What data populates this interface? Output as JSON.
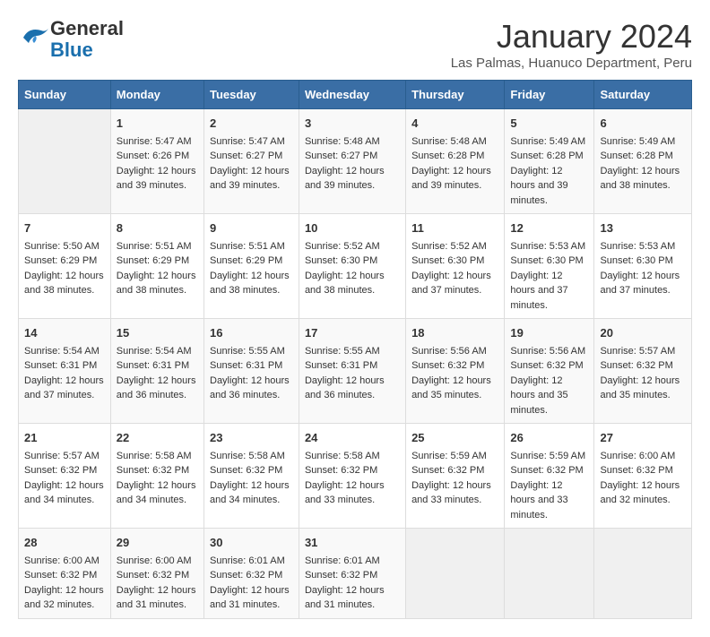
{
  "header": {
    "logo_general": "General",
    "logo_blue": "Blue",
    "month": "January 2024",
    "location": "Las Palmas, Huanuco Department, Peru"
  },
  "weekdays": [
    "Sunday",
    "Monday",
    "Tuesday",
    "Wednesday",
    "Thursday",
    "Friday",
    "Saturday"
  ],
  "weeks": [
    [
      {
        "day": "",
        "sunrise": "",
        "sunset": "",
        "daylight": ""
      },
      {
        "day": "1",
        "sunrise": "Sunrise: 5:47 AM",
        "sunset": "Sunset: 6:26 PM",
        "daylight": "Daylight: 12 hours and 39 minutes."
      },
      {
        "day": "2",
        "sunrise": "Sunrise: 5:47 AM",
        "sunset": "Sunset: 6:27 PM",
        "daylight": "Daylight: 12 hours and 39 minutes."
      },
      {
        "day": "3",
        "sunrise": "Sunrise: 5:48 AM",
        "sunset": "Sunset: 6:27 PM",
        "daylight": "Daylight: 12 hours and 39 minutes."
      },
      {
        "day": "4",
        "sunrise": "Sunrise: 5:48 AM",
        "sunset": "Sunset: 6:28 PM",
        "daylight": "Daylight: 12 hours and 39 minutes."
      },
      {
        "day": "5",
        "sunrise": "Sunrise: 5:49 AM",
        "sunset": "Sunset: 6:28 PM",
        "daylight": "Daylight: 12 hours and 39 minutes."
      },
      {
        "day": "6",
        "sunrise": "Sunrise: 5:49 AM",
        "sunset": "Sunset: 6:28 PM",
        "daylight": "Daylight: 12 hours and 38 minutes."
      }
    ],
    [
      {
        "day": "7",
        "sunrise": "Sunrise: 5:50 AM",
        "sunset": "Sunset: 6:29 PM",
        "daylight": "Daylight: 12 hours and 38 minutes."
      },
      {
        "day": "8",
        "sunrise": "Sunrise: 5:51 AM",
        "sunset": "Sunset: 6:29 PM",
        "daylight": "Daylight: 12 hours and 38 minutes."
      },
      {
        "day": "9",
        "sunrise": "Sunrise: 5:51 AM",
        "sunset": "Sunset: 6:29 PM",
        "daylight": "Daylight: 12 hours and 38 minutes."
      },
      {
        "day": "10",
        "sunrise": "Sunrise: 5:52 AM",
        "sunset": "Sunset: 6:30 PM",
        "daylight": "Daylight: 12 hours and 38 minutes."
      },
      {
        "day": "11",
        "sunrise": "Sunrise: 5:52 AM",
        "sunset": "Sunset: 6:30 PM",
        "daylight": "Daylight: 12 hours and 37 minutes."
      },
      {
        "day": "12",
        "sunrise": "Sunrise: 5:53 AM",
        "sunset": "Sunset: 6:30 PM",
        "daylight": "Daylight: 12 hours and 37 minutes."
      },
      {
        "day": "13",
        "sunrise": "Sunrise: 5:53 AM",
        "sunset": "Sunset: 6:30 PM",
        "daylight": "Daylight: 12 hours and 37 minutes."
      }
    ],
    [
      {
        "day": "14",
        "sunrise": "Sunrise: 5:54 AM",
        "sunset": "Sunset: 6:31 PM",
        "daylight": "Daylight: 12 hours and 37 minutes."
      },
      {
        "day": "15",
        "sunrise": "Sunrise: 5:54 AM",
        "sunset": "Sunset: 6:31 PM",
        "daylight": "Daylight: 12 hours and 36 minutes."
      },
      {
        "day": "16",
        "sunrise": "Sunrise: 5:55 AM",
        "sunset": "Sunset: 6:31 PM",
        "daylight": "Daylight: 12 hours and 36 minutes."
      },
      {
        "day": "17",
        "sunrise": "Sunrise: 5:55 AM",
        "sunset": "Sunset: 6:31 PM",
        "daylight": "Daylight: 12 hours and 36 minutes."
      },
      {
        "day": "18",
        "sunrise": "Sunrise: 5:56 AM",
        "sunset": "Sunset: 6:32 PM",
        "daylight": "Daylight: 12 hours and 35 minutes."
      },
      {
        "day": "19",
        "sunrise": "Sunrise: 5:56 AM",
        "sunset": "Sunset: 6:32 PM",
        "daylight": "Daylight: 12 hours and 35 minutes."
      },
      {
        "day": "20",
        "sunrise": "Sunrise: 5:57 AM",
        "sunset": "Sunset: 6:32 PM",
        "daylight": "Daylight: 12 hours and 35 minutes."
      }
    ],
    [
      {
        "day": "21",
        "sunrise": "Sunrise: 5:57 AM",
        "sunset": "Sunset: 6:32 PM",
        "daylight": "Daylight: 12 hours and 34 minutes."
      },
      {
        "day": "22",
        "sunrise": "Sunrise: 5:58 AM",
        "sunset": "Sunset: 6:32 PM",
        "daylight": "Daylight: 12 hours and 34 minutes."
      },
      {
        "day": "23",
        "sunrise": "Sunrise: 5:58 AM",
        "sunset": "Sunset: 6:32 PM",
        "daylight": "Daylight: 12 hours and 34 minutes."
      },
      {
        "day": "24",
        "sunrise": "Sunrise: 5:58 AM",
        "sunset": "Sunset: 6:32 PM",
        "daylight": "Daylight: 12 hours and 33 minutes."
      },
      {
        "day": "25",
        "sunrise": "Sunrise: 5:59 AM",
        "sunset": "Sunset: 6:32 PM",
        "daylight": "Daylight: 12 hours and 33 minutes."
      },
      {
        "day": "26",
        "sunrise": "Sunrise: 5:59 AM",
        "sunset": "Sunset: 6:32 PM",
        "daylight": "Daylight: 12 hours and 33 minutes."
      },
      {
        "day": "27",
        "sunrise": "Sunrise: 6:00 AM",
        "sunset": "Sunset: 6:32 PM",
        "daylight": "Daylight: 12 hours and 32 minutes."
      }
    ],
    [
      {
        "day": "28",
        "sunrise": "Sunrise: 6:00 AM",
        "sunset": "Sunset: 6:32 PM",
        "daylight": "Daylight: 12 hours and 32 minutes."
      },
      {
        "day": "29",
        "sunrise": "Sunrise: 6:00 AM",
        "sunset": "Sunset: 6:32 PM",
        "daylight": "Daylight: 12 hours and 31 minutes."
      },
      {
        "day": "30",
        "sunrise": "Sunrise: 6:01 AM",
        "sunset": "Sunset: 6:32 PM",
        "daylight": "Daylight: 12 hours and 31 minutes."
      },
      {
        "day": "31",
        "sunrise": "Sunrise: 6:01 AM",
        "sunset": "Sunset: 6:32 PM",
        "daylight": "Daylight: 12 hours and 31 minutes."
      },
      {
        "day": "",
        "sunrise": "",
        "sunset": "",
        "daylight": ""
      },
      {
        "day": "",
        "sunrise": "",
        "sunset": "",
        "daylight": ""
      },
      {
        "day": "",
        "sunrise": "",
        "sunset": "",
        "daylight": ""
      }
    ]
  ]
}
